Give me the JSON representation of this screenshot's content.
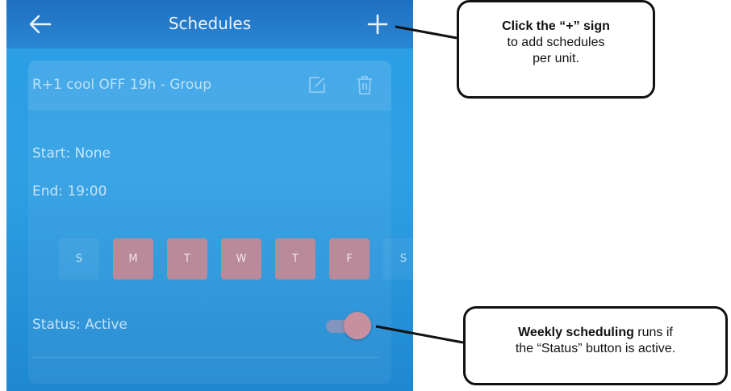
{
  "header": {
    "title": "Schedules"
  },
  "schedule": {
    "name": "R+1 cool OFF 19h - Group",
    "start": "Start: None",
    "end": "End: 19:00",
    "days": [
      {
        "label": "S",
        "active": false
      },
      {
        "label": "M",
        "active": true
      },
      {
        "label": "T",
        "active": true
      },
      {
        "label": "W",
        "active": true
      },
      {
        "label": "T",
        "active": true
      },
      {
        "label": "F",
        "active": true
      },
      {
        "label": "S",
        "active": false
      }
    ],
    "status": "Status: Active",
    "status_on": true
  },
  "callouts": {
    "add": {
      "bold": "Click the “+” sign",
      "line2": "to add schedules",
      "line3": "per unit."
    },
    "status": {
      "bold": "Weekly scheduling",
      "rest": " runs if",
      "line2": "the “Status” button is active."
    }
  },
  "colors": {
    "header_bg": "#1f6fc0",
    "screen_bg": "#2a9ee6",
    "day_active": "#b98a99",
    "toggle_on": "#c88f9f"
  }
}
